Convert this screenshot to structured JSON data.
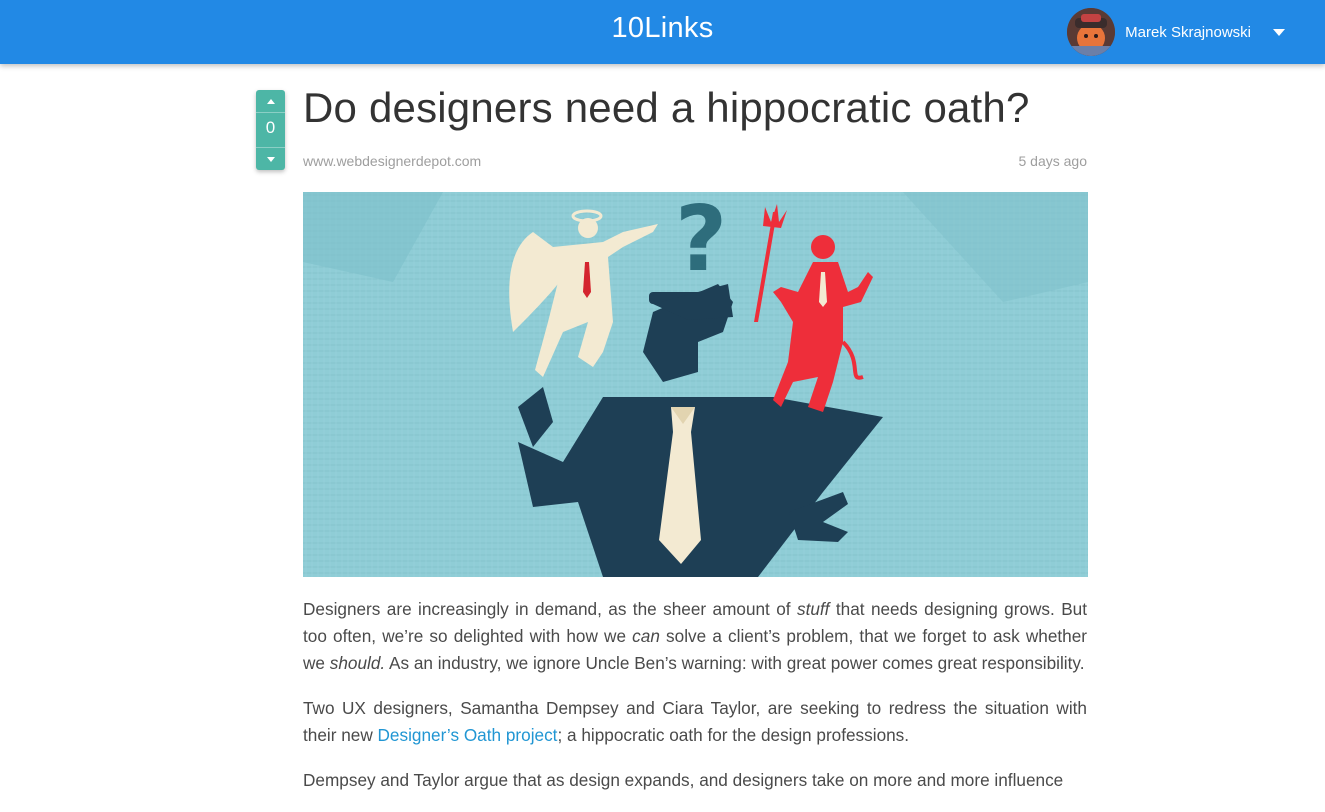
{
  "header": {
    "brand": "10Links",
    "user_name": "Marek Skrajnowski",
    "avatar_icon": "user-avatar",
    "menu_icon": "caret-down-icon"
  },
  "post": {
    "votes": "0",
    "title": "Do designers need a hippocratic oath?",
    "source": "www.webdesignerdepot.com",
    "time": "5 days ago",
    "image_question_mark": "?"
  },
  "article": {
    "p1": {
      "a": "Designers are increasingly in demand, as the sheer amount of ",
      "em1": "stuff",
      "b": " that needs designing grows. But too often, we’re so delighted with how we ",
      "em2": "can",
      "c": " solve a client’s problem, that we forget to ask whether we ",
      "em3": "should.",
      "d": " As an industry, we ignore Uncle Ben’s warning: with great power comes great responsibility."
    },
    "p2": {
      "a": "Two UX designers, Samantha Dempsey and Ciara Taylor, are seeking to redress the situation with their new ",
      "link": "Designer’s Oath project",
      "b": "; a hippocratic oath for the design professions."
    },
    "p3": "Dempsey and Taylor argue that as design expands, and designers take on more and more influence"
  },
  "colors": {
    "topbar": "#2289e5",
    "vote": "#4db6a6",
    "link": "#2196d3",
    "hero_bg": "#8fcdd6",
    "figure": "#1e3f55",
    "angel": "#f3ead2",
    "devil": "#ee2e3a"
  }
}
